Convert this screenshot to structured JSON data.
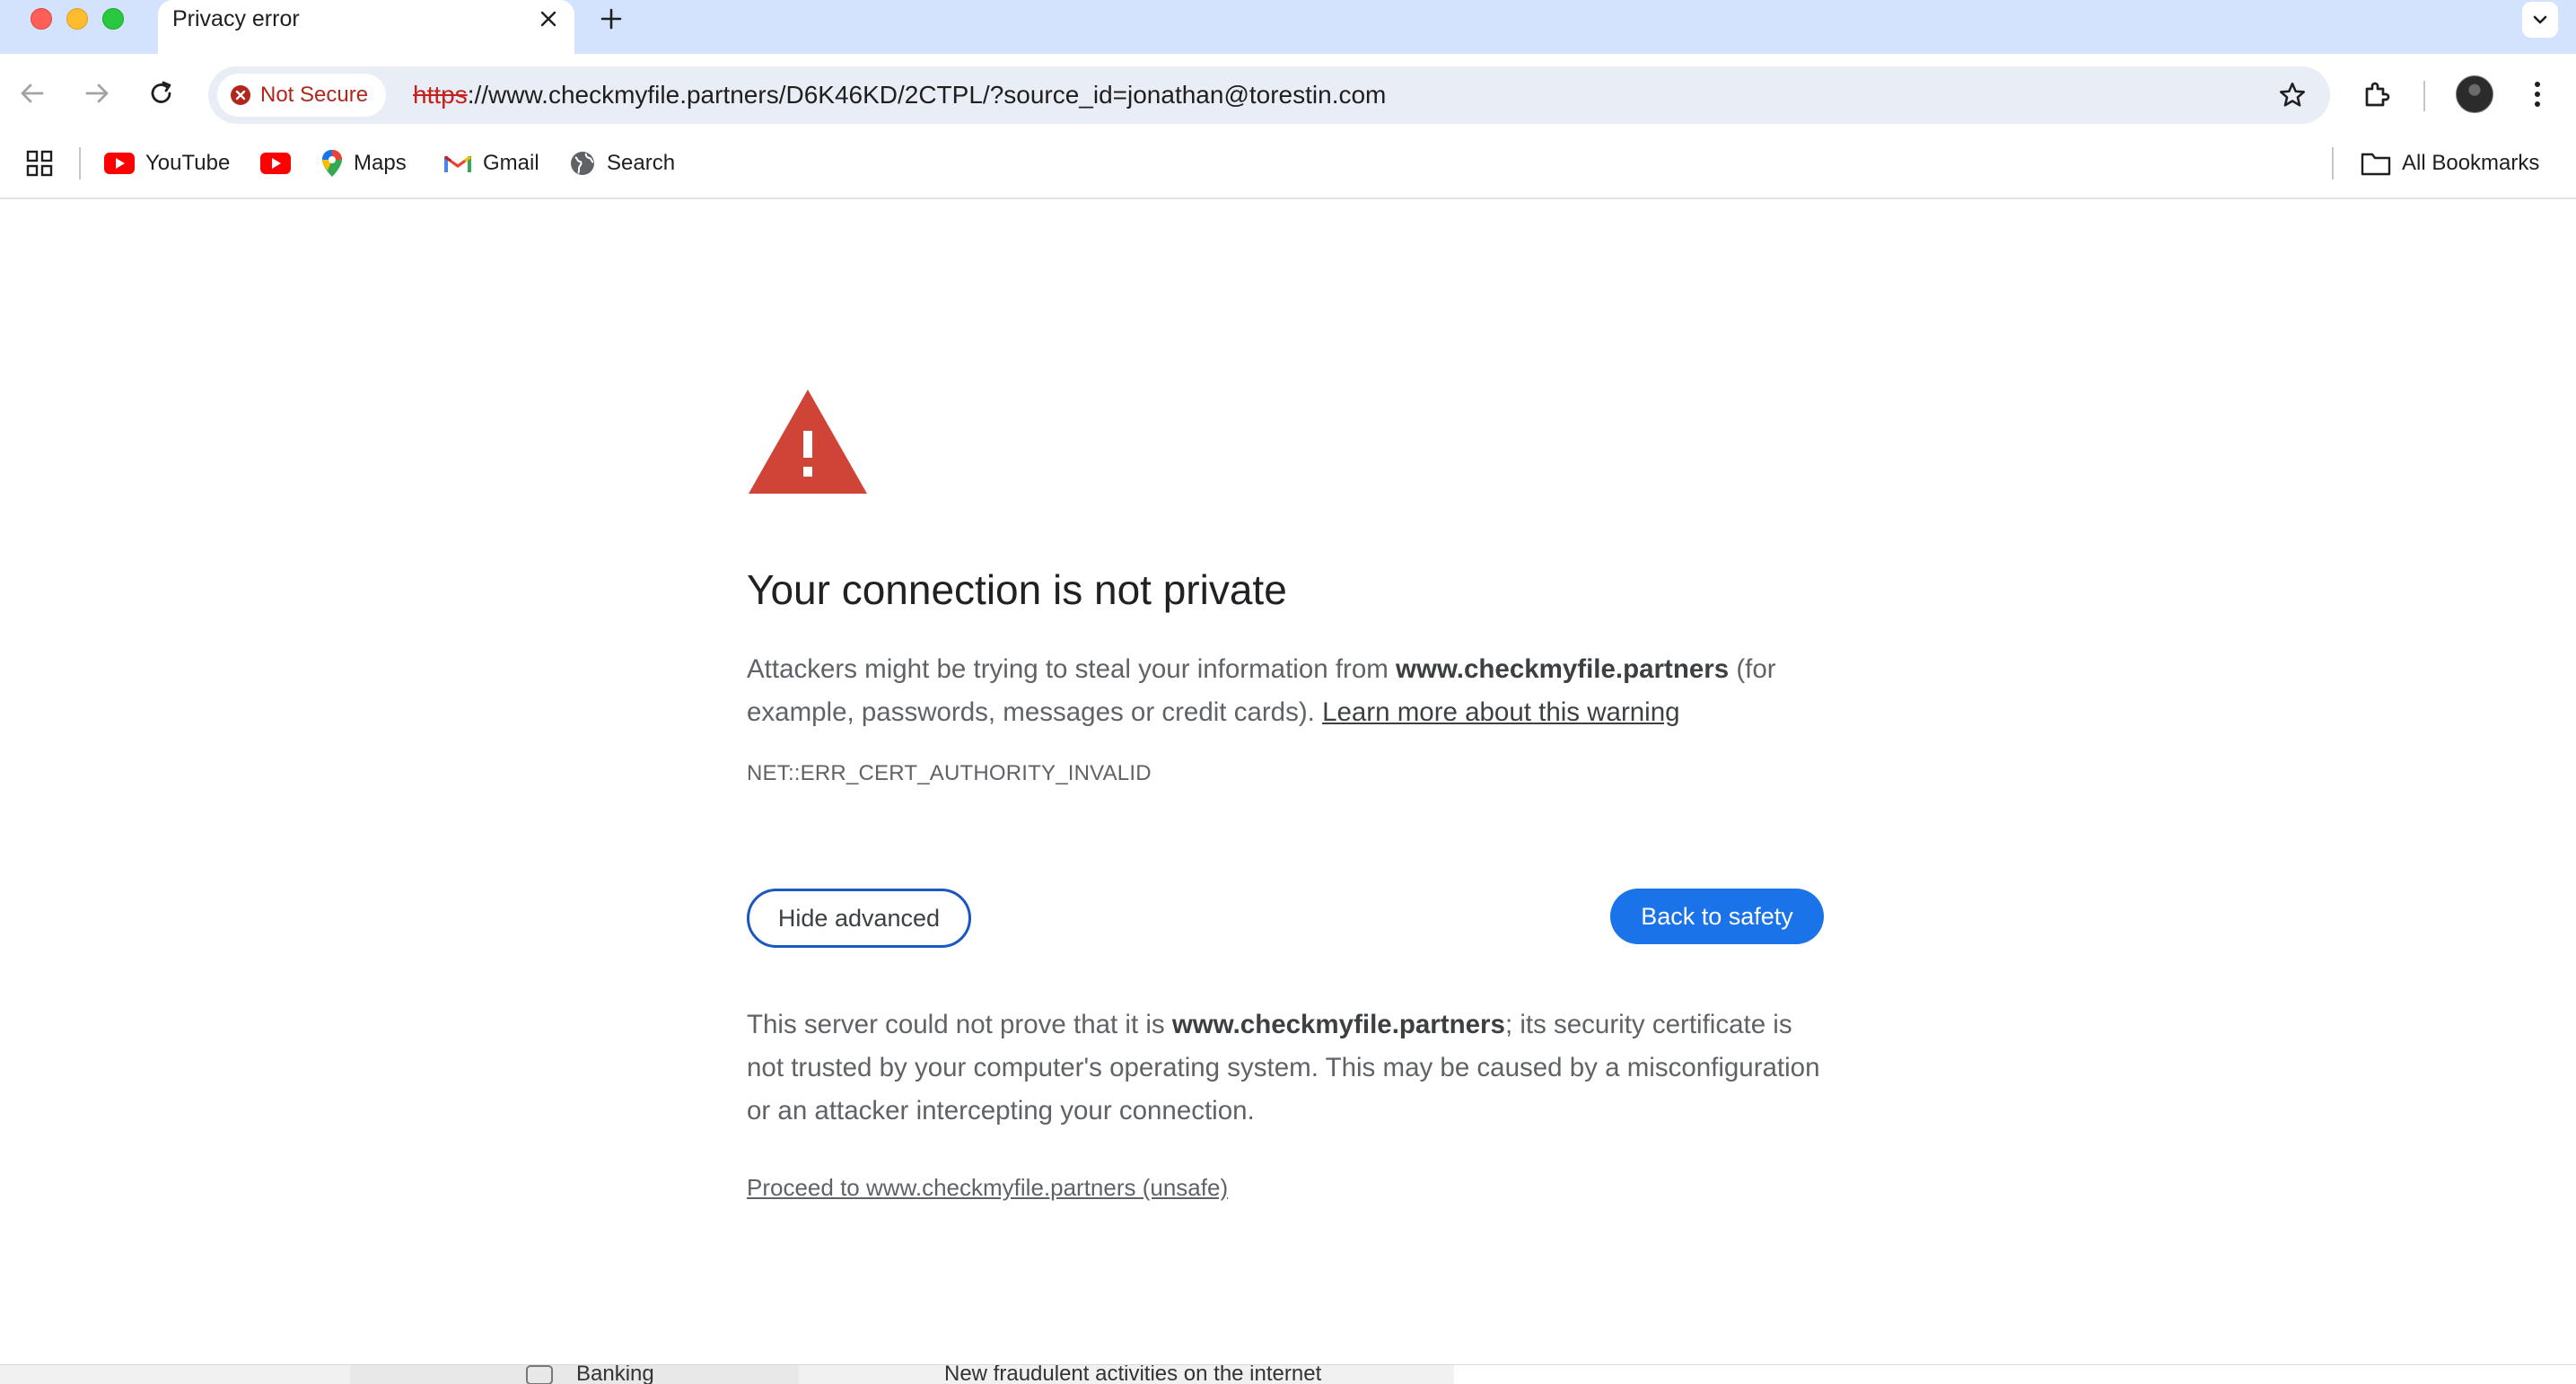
{
  "tab": {
    "title": "Privacy error"
  },
  "toolbar": {
    "security_chip": "Not Secure",
    "url_scheme": "https",
    "url_rest": "://www.checkmyfile.partners/D6K46KD/2CTPL/?source_id=jonathan@torestin.com"
  },
  "bookmarks": {
    "items": [
      {
        "label": "YouTube",
        "icon": "youtube-icon"
      },
      {
        "label": "",
        "icon": "youtube-icon"
      },
      {
        "label": "Maps",
        "icon": "maps-pin-icon"
      },
      {
        "label": "Gmail",
        "icon": "gmail-icon"
      },
      {
        "label": "Search",
        "icon": "globe-icon"
      }
    ],
    "all_bookmarks": "All Bookmarks"
  },
  "interstitial": {
    "heading": "Your connection is not private",
    "para1_prefix": "Attackers might be trying to steal your information from ",
    "domain": "www.checkmyfile.partners",
    "para1_suffix": " (for example, passwords, messages or credit cards). ",
    "learn_more": "Learn more about this warning",
    "error_code": "NET::ERR_CERT_AUTHORITY_INVALID",
    "hide_advanced": "Hide advanced",
    "back_to_safety": "Back to safety",
    "para2_prefix": "This server could not prove that it is ",
    "para2_suffix": "; its security certificate is not trusted by your computer's operating system. This may be caused by a misconfiguration or an attacker intercepting your connection.",
    "proceed_link": "Proceed to www.checkmyfile.partners (unsafe)"
  },
  "background_window": {
    "item_banking": "Banking",
    "headline": "New fraudulent activities on the internet"
  },
  "colors": {
    "warning_red": "#d04437",
    "accent_blue": "#1a73e8",
    "tabstrip": "#d3e3fd"
  }
}
